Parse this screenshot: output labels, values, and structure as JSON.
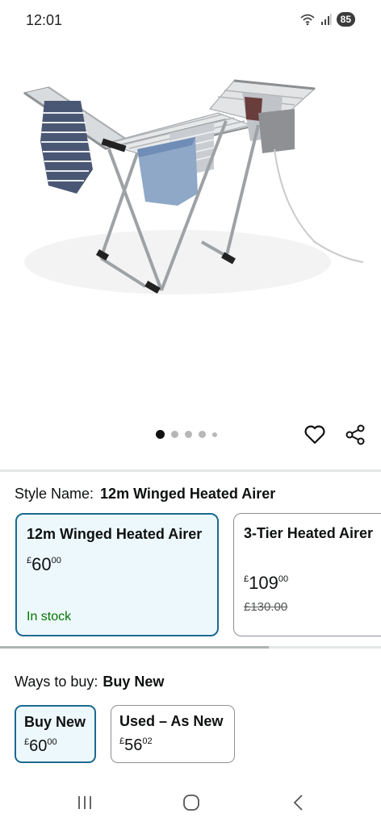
{
  "status_bar": {
    "time": "12:01",
    "battery": "85",
    "icons": [
      "wifi-icon",
      "signal-icon",
      "battery-icon"
    ]
  },
  "product": {
    "image_icon": "clothes-airer-image",
    "carousel_total": 5,
    "carousel_active": 1
  },
  "style": {
    "label": "Style Name:",
    "value": "12m Winged Heated Airer",
    "options": [
      {
        "title": "12m Winged Heated Airer",
        "currency": "£",
        "price_whole": "60",
        "price_fraction": "00",
        "availability": "In stock",
        "selected": true
      },
      {
        "title": "3-Tier Heated Airer",
        "currency": "£",
        "price_whole": "109",
        "price_fraction": "00",
        "was_price": "£130.00",
        "selected": false
      }
    ]
  },
  "ways_to_buy": {
    "label": "Ways to buy:",
    "value": "Buy New",
    "options": [
      {
        "title": "Buy New",
        "currency": "£",
        "price_whole": "60",
        "price_fraction": "00",
        "selected": true
      },
      {
        "title": "Used – As New",
        "currency": "£",
        "price_whole": "56",
        "price_fraction": "02",
        "selected": false
      }
    ]
  },
  "colors": {
    "accent_border": "#1b6a8f",
    "selected_bg": "#edf8fd",
    "in_stock": "#007600"
  },
  "nav": {
    "icons": [
      "recent-apps-icon",
      "home-icon",
      "back-icon"
    ]
  }
}
